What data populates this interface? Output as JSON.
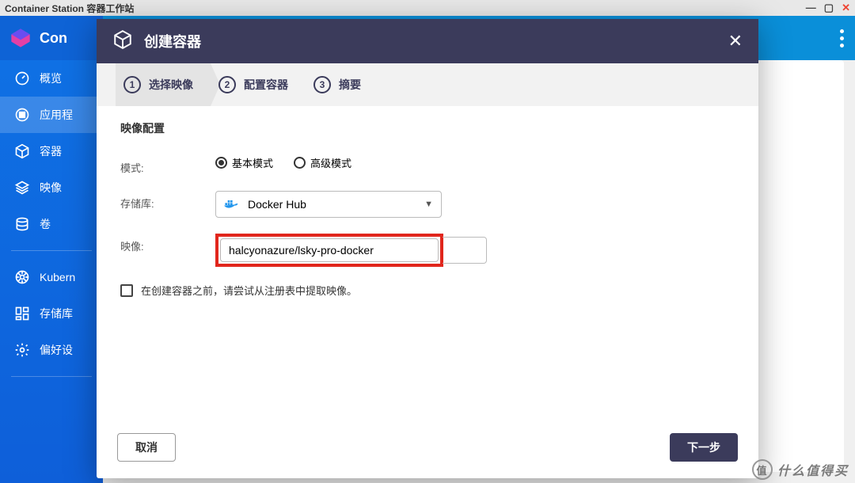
{
  "window": {
    "title": "Container Station 容器工作站"
  },
  "brand": {
    "label": "Con"
  },
  "sidebar": {
    "items": [
      {
        "label": "概览"
      },
      {
        "label": "应用程"
      },
      {
        "label": "容器"
      },
      {
        "label": "映像"
      },
      {
        "label": "卷"
      },
      {
        "label": "Kubern"
      },
      {
        "label": "存储库"
      },
      {
        "label": "偏好设"
      }
    ]
  },
  "modal": {
    "title": "创建容器",
    "close": "✕",
    "section_title": "映像配置",
    "steps": [
      {
        "num": "1",
        "label": "选择映像"
      },
      {
        "num": "2",
        "label": "配置容器"
      },
      {
        "num": "3",
        "label": "摘要"
      }
    ],
    "fields": {
      "mode_label": "模式:",
      "mode_basic": "基本模式",
      "mode_advanced": "高级模式",
      "repo_label": "存储库:",
      "repo_value": "Docker Hub",
      "image_label": "映像:",
      "image_value": "halcyonazure/lsky-pro-docker",
      "precheck_label": "在创建容器之前，请尝试从注册表中提取映像。"
    },
    "footer": {
      "cancel": "取消",
      "next": "下一步"
    }
  },
  "watermark": {
    "text": "什么值得买",
    "badge": "值"
  }
}
